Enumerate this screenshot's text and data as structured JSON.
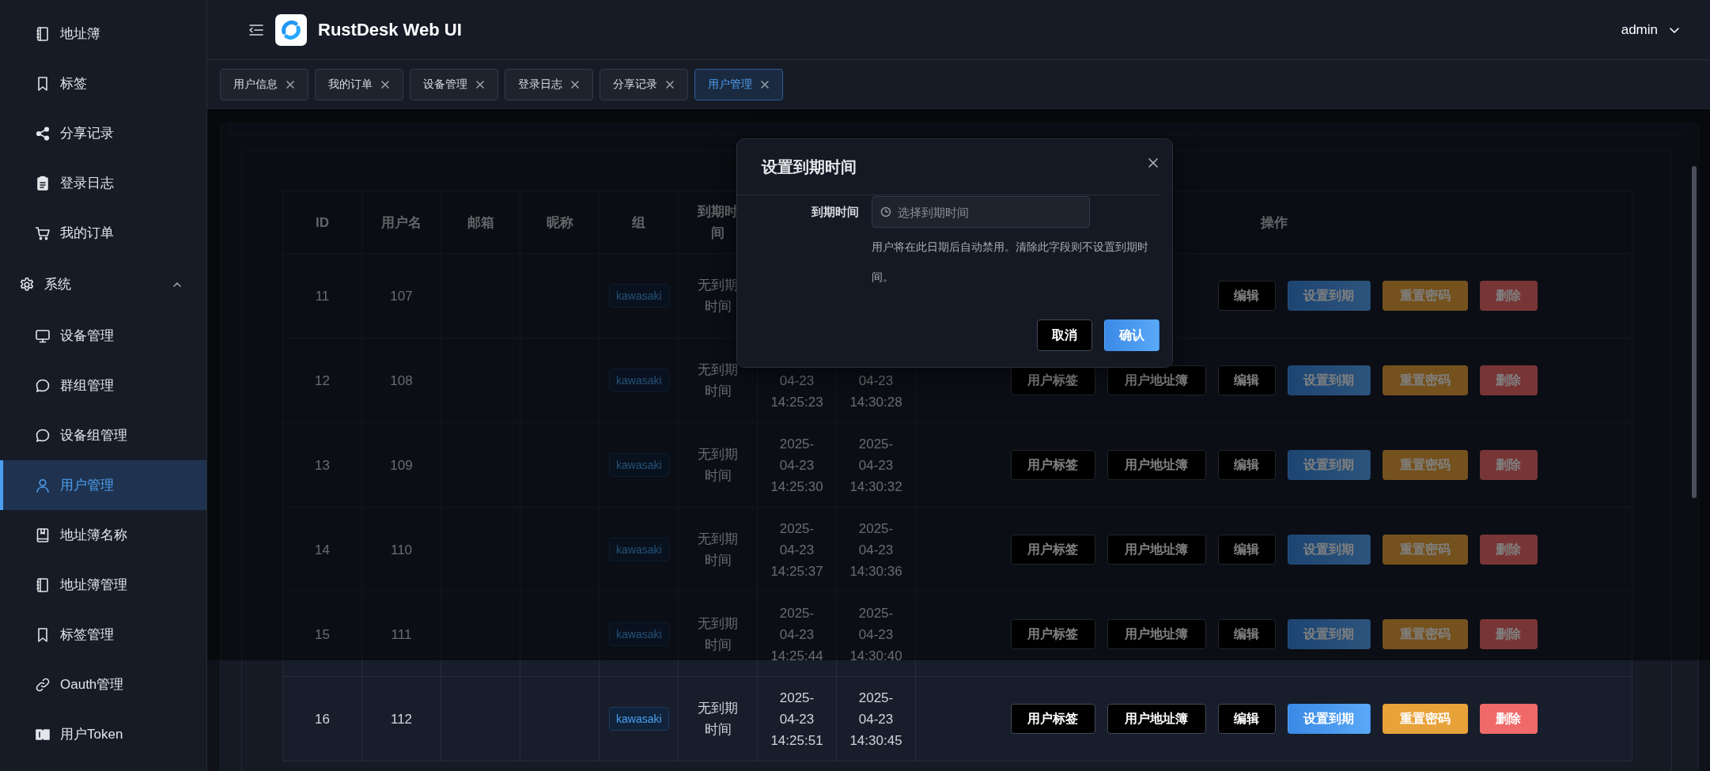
{
  "header": {
    "title": "RustDesk Web UI",
    "user": "admin"
  },
  "sidebar": {
    "items": [
      {
        "label": "地址簿",
        "selected": false
      },
      {
        "label": "标签",
        "selected": false
      },
      {
        "label": "分享记录",
        "selected": false
      },
      {
        "label": "登录日志",
        "selected": false
      },
      {
        "label": "我的订单",
        "selected": false
      },
      {
        "label": "系统",
        "expanded": true,
        "children": [
          {
            "label": "设备管理",
            "selected": false
          },
          {
            "label": "群组管理",
            "selected": false
          },
          {
            "label": "设备组管理",
            "selected": false
          },
          {
            "label": "用户管理",
            "selected": true
          },
          {
            "label": "地址簿名称",
            "selected": false
          },
          {
            "label": "地址簿管理",
            "selected": false
          },
          {
            "label": "标签管理",
            "selected": false
          },
          {
            "label": "Oauth管理",
            "selected": false
          },
          {
            "label": "用户Token",
            "selected": false
          }
        ]
      }
    ]
  },
  "tabs": [
    {
      "label": "用户信息",
      "selected": false
    },
    {
      "label": "我的订单",
      "selected": false
    },
    {
      "label": "设备管理",
      "selected": false
    },
    {
      "label": "登录日志",
      "selected": false
    },
    {
      "label": "分享记录",
      "selected": false
    },
    {
      "label": "用户管理",
      "selected": true
    }
  ],
  "table": {
    "columns": [
      {
        "label": "ID"
      },
      {
        "label": "用户名"
      },
      {
        "label": "邮箱"
      },
      {
        "label": "昵称"
      },
      {
        "label": "组"
      },
      {
        "label": "到期时间"
      },
      null,
      null,
      {
        "label": "操作"
      }
    ],
    "rows": [
      {
        "id": "11",
        "username": "107",
        "group": "kawasaki",
        "expiry": "无到期时间",
        "actions": [
          {
            "label": "编辑",
            "kind": "edit"
          },
          {
            "label": "设置到期",
            "kind": "expiry"
          },
          {
            "label": "重置密码",
            "kind": "reset"
          },
          {
            "label": "删除",
            "kind": "delete"
          }
        ]
      },
      {
        "id": "12",
        "username": "108",
        "group": "kawasaki",
        "expiry": "无到期时间",
        "created": "04-23\n14:25:23",
        "updated": "04-23\n14:30:28",
        "actions": [
          {
            "label": "用户标签",
            "kind": "tags"
          },
          {
            "label": "用户地址簿",
            "kind": "addressbook"
          },
          {
            "label": "编辑",
            "kind": "edit"
          },
          {
            "label": "设置到期",
            "kind": "expiry"
          },
          {
            "label": "重置密码",
            "kind": "reset"
          },
          {
            "label": "删除",
            "kind": "delete"
          }
        ]
      },
      {
        "id": "13",
        "username": "109",
        "group": "kawasaki",
        "expiry": "无到期时间",
        "created": "2025-\n04-23\n14:25:30",
        "updated": "2025-\n04-23\n14:30:32",
        "actions": [
          {
            "label": "用户标签",
            "kind": "tags"
          },
          {
            "label": "用户地址簿",
            "kind": "addressbook"
          },
          {
            "label": "编辑",
            "kind": "edit"
          },
          {
            "label": "设置到期",
            "kind": "expiry"
          },
          {
            "label": "重置密码",
            "kind": "reset"
          },
          {
            "label": "删除",
            "kind": "delete"
          }
        ]
      },
      {
        "id": "14",
        "username": "110",
        "group": "kawasaki",
        "expiry": "无到期时间",
        "created": "2025-\n04-23\n14:25:37",
        "updated": "2025-\n04-23\n14:30:36",
        "actions": [
          {
            "label": "用户标签",
            "kind": "tags"
          },
          {
            "label": "用户地址簿",
            "kind": "addressbook"
          },
          {
            "label": "编辑",
            "kind": "edit"
          },
          {
            "label": "设置到期",
            "kind": "expiry"
          },
          {
            "label": "重置密码",
            "kind": "reset"
          },
          {
            "label": "删除",
            "kind": "delete"
          }
        ]
      },
      {
        "id": "15",
        "username": "111",
        "group": "kawasaki",
        "expiry": "无到期时间",
        "created": "2025-\n04-23\n14:25:44",
        "updated": "2025-\n04-23\n14:30:40",
        "actions": [
          {
            "label": "用户标签",
            "kind": "tags"
          },
          {
            "label": "用户地址簿",
            "kind": "addressbook"
          },
          {
            "label": "编辑",
            "kind": "edit"
          },
          {
            "label": "设置到期",
            "kind": "expiry"
          },
          {
            "label": "重置密码",
            "kind": "reset"
          },
          {
            "label": "删除",
            "kind": "delete"
          }
        ]
      },
      {
        "id": "16",
        "username": "112",
        "group": "kawasaki",
        "expiry": "无到期时间",
        "created": "2025-\n04-23\n14:25:51",
        "updated": "2025-\n04-23\n14:30:45",
        "actions": [
          {
            "label": "用户标签",
            "kind": "tags"
          },
          {
            "label": "用户地址簿",
            "kind": "addressbook"
          },
          {
            "label": "编辑",
            "kind": "edit"
          },
          {
            "label": "设置到期",
            "kind": "expiry"
          },
          {
            "label": "重置密码",
            "kind": "reset"
          },
          {
            "label": "删除",
            "kind": "delete"
          }
        ]
      }
    ]
  },
  "dialog": {
    "title": "设置到期时间",
    "field": {
      "label": "到期时间",
      "placeholder": "选择到期时间"
    },
    "help": "用户将在此日期后自动禁用。清除此字段则不设置到期时间。",
    "buttons": [
      {
        "label": "取消",
        "kind": "default"
      },
      {
        "label": "确认",
        "kind": "primary"
      }
    ]
  }
}
